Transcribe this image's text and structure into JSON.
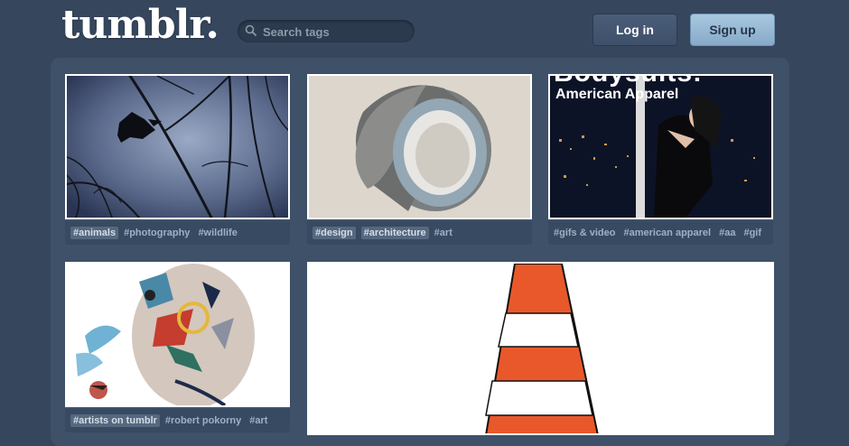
{
  "header": {
    "logo": "tumblr.",
    "search_placeholder": "Search tags",
    "login_label": "Log in",
    "signup_label": "Sign up"
  },
  "colors": {
    "background": "#36465d",
    "dashboard": "#3f5169",
    "signup_button": "#a9c8e0"
  },
  "posts": [
    {
      "image": "silhouette of crow among bare branches",
      "tags": [
        "#animals",
        "#photography",
        "#wildlife"
      ],
      "highlighted": [
        true,
        false,
        false
      ]
    },
    {
      "image": "roll of tape",
      "tags": [
        "#design",
        "#architecture",
        "#art"
      ],
      "highlighted": [
        true,
        true,
        false
      ]
    },
    {
      "image": "American Apparel magazine cover",
      "overlay_title": "Bodysuits!",
      "overlay_subtitle": "American Apparel",
      "tags": [
        "#gifs & video",
        "#american apparel",
        "#aa",
        "#gif"
      ],
      "highlighted": [
        false,
        false,
        false,
        false
      ]
    },
    {
      "image": "abstract face illustration",
      "tags": [
        "#artists on tumblr",
        "#robert pokorny",
        "#art"
      ],
      "highlighted": [
        true,
        false,
        false
      ]
    },
    {
      "image": "orange traffic cone",
      "tags": []
    }
  ]
}
